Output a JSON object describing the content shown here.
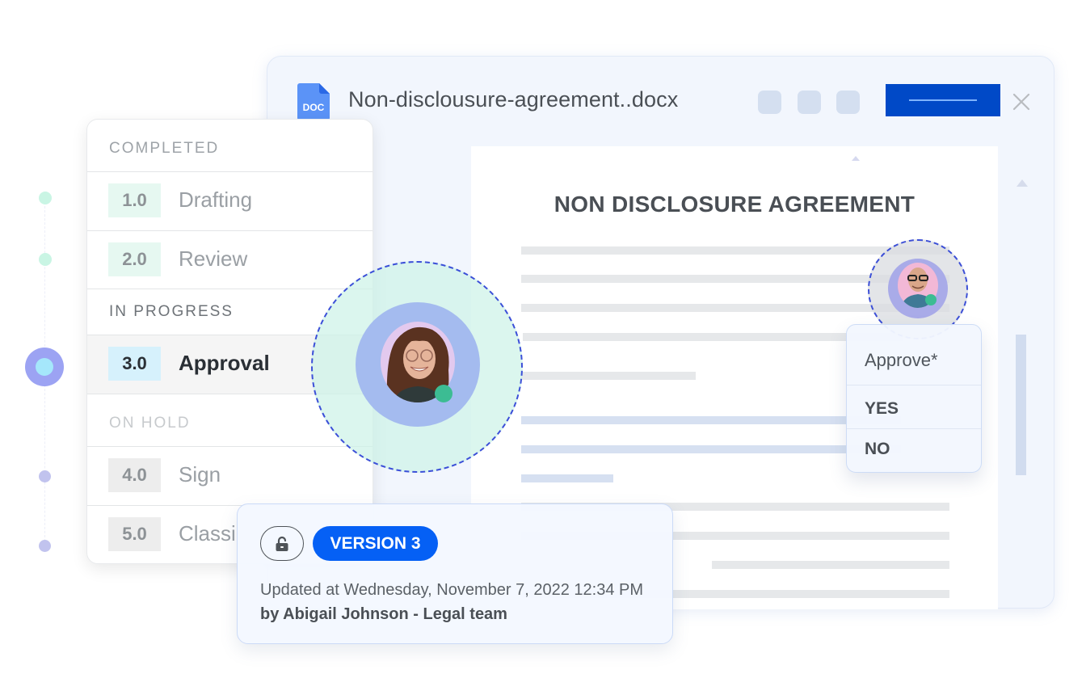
{
  "document": {
    "file_icon": "doc-file-icon",
    "file_icon_label": "DOC",
    "title": "Non-disclousure-agreement..docx",
    "heading": "NON DISCLOSURE AGREEMENT",
    "toolbar_icons": [
      "toolbar-placeholder-icon",
      "toolbar-placeholder-icon",
      "toolbar-placeholder-icon"
    ],
    "close_icon": "close-icon",
    "colors": {
      "primary_button": "#0049c7",
      "window_bg": "#f2f6fd"
    }
  },
  "stages": {
    "sections": [
      {
        "label": "COMPLETED",
        "items": [
          {
            "number": "1.0",
            "name": "Drafting"
          },
          {
            "number": "2.0",
            "name": "Review"
          }
        ]
      },
      {
        "label": "IN PROGRESS",
        "items": [
          {
            "number": "3.0",
            "name": "Approval"
          }
        ]
      },
      {
        "label": "ON HOLD",
        "items": [
          {
            "number": "4.0",
            "name": "Sign"
          },
          {
            "number": "5.0",
            "name": "Classi"
          }
        ]
      }
    ],
    "colors": {
      "completed": "#c9f5e4",
      "current": "#9ca3f3",
      "on_hold": "#c1c3ee"
    }
  },
  "approval": {
    "label": "Approve*",
    "options": [
      "YES",
      "NO"
    ],
    "status_color": "#3cbc93"
  },
  "version": {
    "lock_icon": "unlocked-padlock-icon",
    "badge": "VERSION 3",
    "updated_prefix": "Updated at Wednesday, November 7, 2022 12:34 PM",
    "updated_by": "by Abigail Johnson - Legal team",
    "badge_color": "#0560f5"
  }
}
